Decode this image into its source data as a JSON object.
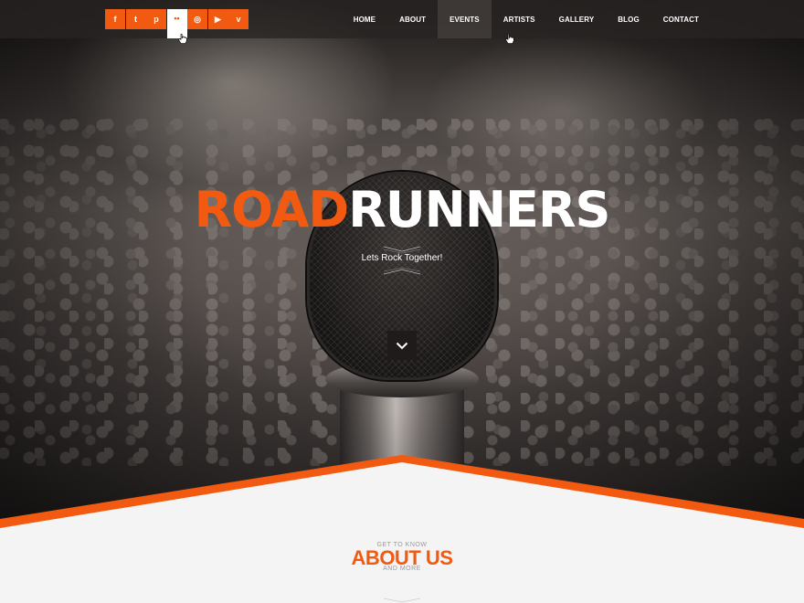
{
  "colors": {
    "accent": "#f15a10",
    "topbar": "#2a2624",
    "section_bg": "#f4f4f4"
  },
  "social_icons": [
    {
      "name": "facebook-icon",
      "glyph": "f"
    },
    {
      "name": "twitter-icon",
      "glyph": "t"
    },
    {
      "name": "pinterest-icon",
      "glyph": "p"
    },
    {
      "name": "flickr-icon",
      "glyph": "••"
    },
    {
      "name": "instagram-icon",
      "glyph": "◎"
    },
    {
      "name": "youtube-icon",
      "glyph": "▶"
    },
    {
      "name": "vimeo-icon",
      "glyph": "v"
    }
  ],
  "nav": {
    "items": [
      "HOME",
      "ABOUT",
      "EVENTS",
      "ARTISTS",
      "GALLERY",
      "BLOG",
      "CONTACT"
    ],
    "active": "EVENTS"
  },
  "hero": {
    "logo_part1": "ROAD",
    "logo_part2": "RUNNERS",
    "tagline": "Lets Rock Together!",
    "scroll_icon": "chevron-down-icon"
  },
  "about": {
    "pre": "GET TO KNOW",
    "title": "ABOUT US",
    "post": "AND MORE"
  }
}
